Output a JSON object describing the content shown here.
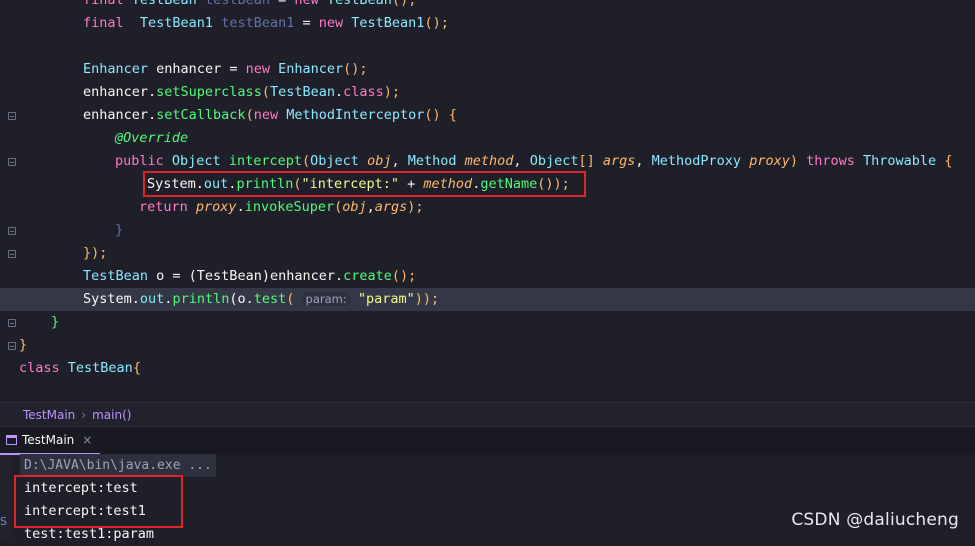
{
  "code": {
    "line0": {
      "kw": "final",
      "type": "TestBean",
      "var": "testBean",
      "op": " = ",
      "new": "new",
      "ctor": "TestBean",
      "tail": "();"
    },
    "line1": {
      "kw": "final",
      "type": "TestBean1",
      "var": "testBean1",
      "op": " = ",
      "new": "new",
      "ctor": "TestBean1",
      "tail": "();"
    },
    "line3": {
      "type": "Enhancer",
      "var": "enhancer",
      "op": " = ",
      "new": "new",
      "ctor": "Enhancer",
      "tail": "();"
    },
    "line4": {
      "obj": "enhancer.",
      "fn": "setSuperclass",
      "open": "(",
      "type": "TestBean",
      "dot": ".",
      "cls": "class",
      "tail": ");"
    },
    "line5": {
      "obj": "enhancer.",
      "fn": "setCallback",
      "open": "(",
      "new": "new",
      "type": "MethodInterceptor",
      "tail": "() {"
    },
    "line6": {
      "ann": "@Override"
    },
    "line7": {
      "public": "public",
      "t1": "Object",
      "fn": "intercept",
      "open": "(",
      "t2": "Object",
      "p1": "obj",
      "c1": ", ",
      "t3": "Method",
      "p2": "method",
      "c2": ", ",
      "t4": "Object",
      "arr": "[]",
      "p3": "args",
      "c3": ", ",
      "t5": "MethodProxy",
      "p4": "proxy",
      "close": ") ",
      "throws": "throws",
      "t6": "Throwable",
      "brace": " {"
    },
    "line8": {
      "sys": "System.",
      "out": "out",
      "dot": ".",
      "fn": "println",
      "open": "(",
      "str": "\"intercept:\"",
      "plus": " + ",
      "par": "method",
      "dot2": ".",
      "fn2": "getName",
      "tail": "());"
    },
    "line9": {
      "ret": "return",
      "par": "proxy",
      "dot": ".",
      "fn": "invokeSuper",
      "open": "(",
      "p1": "obj",
      "c": ",",
      "p2": "args",
      "tail": ");"
    },
    "line10": {
      "brace": "}"
    },
    "line11": {
      "tail": "});"
    },
    "line12": {
      "type": "TestBean",
      "var": " o = ",
      "cast": "(TestBean)",
      "obj": "enhancer.",
      "fn": "create",
      "tail": "();"
    },
    "line13": {
      "sys": "System.",
      "out": "out",
      "dot": ".",
      "fn": "println",
      "open": "(o.",
      "fn2": "test",
      "open2": "(",
      "hint": "param:",
      "str": "\"param\"",
      "tail": "));"
    },
    "line14": {
      "brace": "}"
    },
    "line15": {
      "brace": "}"
    },
    "line16": {
      "kw": "class",
      "type": "TestBean",
      "brace": "{"
    }
  },
  "breadcrumb": {
    "file": "TestMain",
    "separator": "›",
    "method": "main()"
  },
  "run_tab": {
    "label": "TestMain",
    "close": "×"
  },
  "console": {
    "path": "D:\\JAVA\\bin\\java.exe ...",
    "lines": [
      "intercept:test",
      "intercept:test1",
      "test:test1:param"
    ]
  },
  "watermark": "CSDN @daliucheng",
  "colors": {
    "highlight_box": "#e0242a",
    "accent": "#bd93f9"
  }
}
